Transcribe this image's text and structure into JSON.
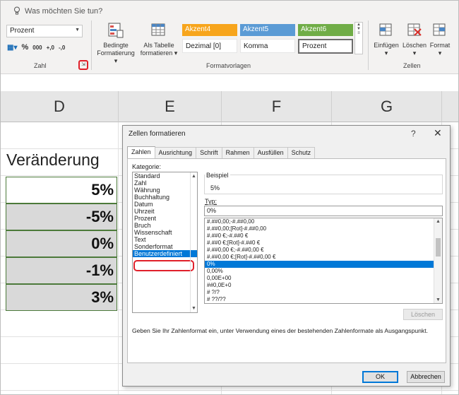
{
  "ribbon": {
    "tellme": "Was möchten Sie tun?",
    "number_format": "Prozent",
    "number_icons": [
      "%",
      "000",
      "+,0",
      "-,0"
    ],
    "group_zahl": "Zahl",
    "bedingte": [
      "Bedingte",
      "Formatierung"
    ],
    "als_tabelle": [
      "Als Tabelle",
      "formatieren"
    ],
    "styles": [
      {
        "label": "Akzent4",
        "color": "#f7a51c"
      },
      {
        "label": "Akzent5",
        "color": "#5b9bd5"
      },
      {
        "label": "Akzent6",
        "color": "#70ad47"
      },
      {
        "label": "Dezimal [0]"
      },
      {
        "label": "Komma"
      },
      {
        "label": "Prozent"
      }
    ],
    "group_formatvorlagen": "Formatvorlagen",
    "einfuegen": "Einfügen",
    "loeschen": "Löschen",
    "format": "Format",
    "group_zellen": "Zellen"
  },
  "sheet": {
    "columns": [
      "D",
      "E",
      "F",
      "G"
    ],
    "header": "Veränderung",
    "values": [
      "5%",
      "-5%",
      "0%",
      "-1%",
      "3%"
    ]
  },
  "dialog": {
    "title": "Zellen formatieren",
    "help": "?",
    "close": "✕",
    "tabs": [
      "Zahlen",
      "Ausrichtung",
      "Schrift",
      "Rahmen",
      "Ausfüllen",
      "Schutz"
    ],
    "kategorie_label": "Kategorie:",
    "kategorien": [
      "Standard",
      "Zahl",
      "Währung",
      "Buchhaltung",
      "Datum",
      "Uhrzeit",
      "Prozent",
      "Bruch",
      "Wissenschaft",
      "Text",
      "Sonderformat",
      "Benutzerdefiniert"
    ],
    "selected_kategorie": "Benutzerdefiniert",
    "beispiel_label": "Beispiel",
    "beispiel_value": "5%",
    "typ_label": "Typ:",
    "typ_value": "0%",
    "formats": [
      "#.##0,00;-#.##0,00",
      "#.##0,00;[Rot]-#.##0,00",
      "#.##0 €;-#.##0 €",
      "#.##0 €;[Rot]-#.##0 €",
      "#.##0,00 €;-#.##0,00 €",
      "#.##0,00 €;[Rot]-#.##0,00 €",
      "0%",
      "0,00%",
      "0,00E+00",
      "##0,0E+0",
      "# ?/?",
      "# ??/??"
    ],
    "selected_format": "0%",
    "loeschen": "Löschen",
    "hint": "Geben Sie Ihr Zahlenformat ein, unter Verwendung eines der bestehenden Zahlenformate als Ausgangspunkt.",
    "ok": "OK",
    "cancel": "Abbrechen"
  }
}
